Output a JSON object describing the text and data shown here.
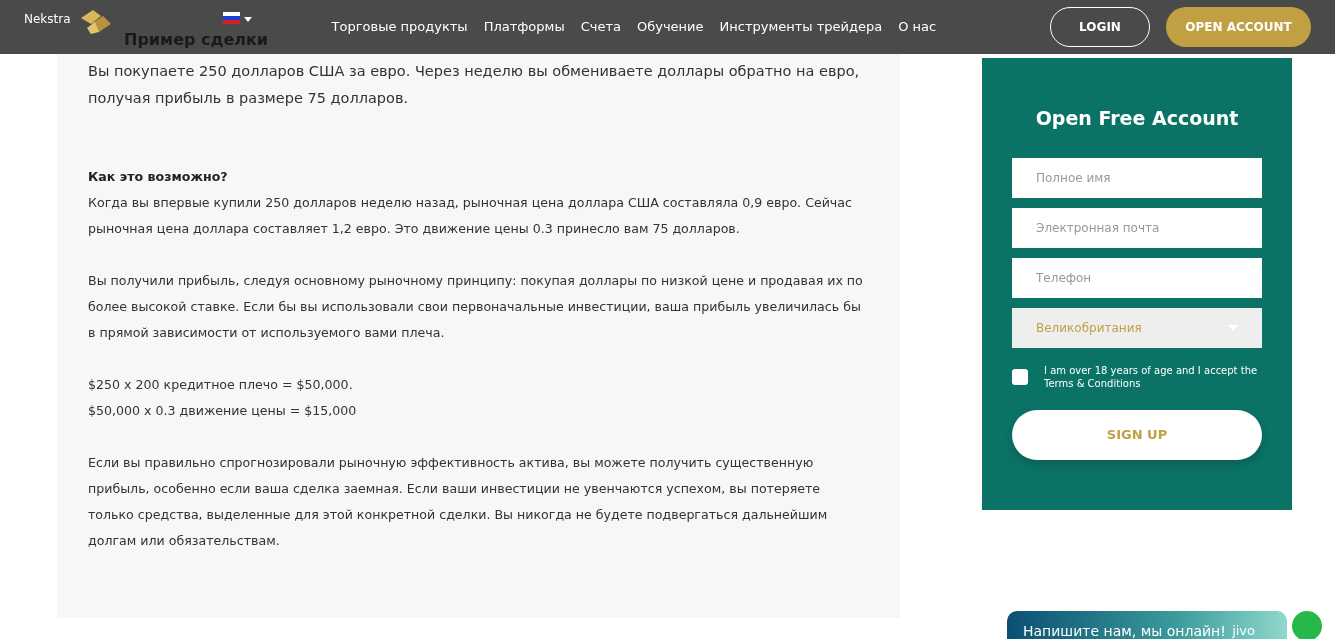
{
  "navbar": {
    "brand": "Nekstra",
    "menu": [
      "Торговые продукты",
      "Платформы",
      "Счета",
      "Обучение",
      "Инструменты трейдера",
      "О нас"
    ],
    "login": "LOGIN",
    "open_account": "OPEN ACCOUNT"
  },
  "article": {
    "heading": "Пример сделки",
    "lead": "Вы покупаете 250 долларов США за евро. Через неделю вы обмениваете доллары обратно на евро, получая прибыль в размере 75 долларов.",
    "blocks": [
      {
        "kind": "subheading",
        "text": "Как это возможно?"
      },
      {
        "kind": "para",
        "text": "Когда вы впервые купили 250 долларов неделю назад, рыночная цена доллара США составляла 0,9 евро. Сейчас рыночная цена доллара составляет 1,2 евро. Это движение цены 0.3 принесло вам 75 долларов."
      },
      {
        "kind": "para",
        "text": "Вы получили прибыль, следуя основному рыночному принципу: покупая доллары по низкой цене и продавая их по более высокой ставке. Если бы вы использовали свои первоначальные инвестиции, ваша прибыль увеличилась бы в прямой зависимости от используемого вами плеча."
      },
      {
        "kind": "line",
        "text": "$250 x 200 кредитное плечо = $50,000."
      },
      {
        "kind": "para",
        "text": "$50,000 x 0.3 движение цены = $15,000"
      },
      {
        "kind": "para",
        "text": "Если вы правильно спрогнозировали рыночную эффективность актива, вы можете получить существенную прибыль, особенно если ваша сделка заемная. Если ваши инвестиции не увенчаются успехом, вы потеряете только средства, выделенные для этой конкретной сделки. Вы никогда не будете подвергаться дальнейшим долгам или обязательствам."
      }
    ]
  },
  "form": {
    "title": "Open Free Account",
    "fields": [
      {
        "placeholder": "Полное имя"
      },
      {
        "placeholder": "Электронная почта"
      },
      {
        "placeholder": "Телефон"
      }
    ],
    "country": "Великобритания",
    "consent": {
      "checked": false,
      "label": "I am over 18 years of age and I accept the Terms & Conditions"
    },
    "submit": "SIGN UP"
  },
  "chat": {
    "text": "Напишите нам, мы онлайн!",
    "brand": "jivo"
  }
}
